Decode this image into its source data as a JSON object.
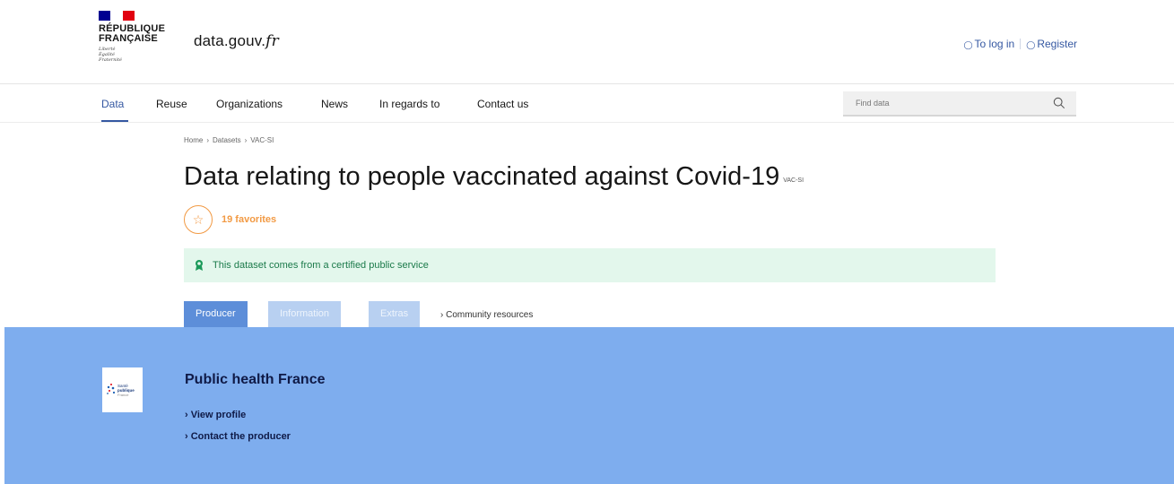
{
  "header": {
    "gov_name_line1": "RÉPUBLIQUE",
    "gov_name_line2": "FRANÇAISE",
    "motto": [
      "Liberté",
      "Égalité",
      "Fraternité"
    ],
    "site_name": "data.gouv.",
    "site_tld": "fr",
    "login_label": "To log in",
    "register_label": "Register"
  },
  "nav": {
    "items": [
      "Data",
      "Reuse",
      "Organizations",
      "News",
      "In regards to",
      "Contact us"
    ],
    "active": "Data",
    "search_placeholder": "Find data"
  },
  "breadcrumb": [
    "Home",
    "Datasets",
    "VAC-SI"
  ],
  "dataset": {
    "title": "Data relating to people vaccinated against Covid-19",
    "acronym": "VAC-SI",
    "favorites": "19 favorites",
    "certified_text": "This dataset comes from a certified public service"
  },
  "tabs": {
    "items": [
      "Producer",
      "Information",
      "Extras"
    ],
    "active": "Producer",
    "community_link": "Community resources"
  },
  "producer": {
    "name": "Public health France",
    "logo_text": [
      "Santé",
      "publique",
      "France"
    ],
    "view_profile": "View profile",
    "contact": "Contact the producer"
  },
  "colors": {
    "primary": "#3558a2",
    "accent_orange": "#f29a44",
    "certified_bg": "#e3f7ec",
    "panel_bg": "#7eadee",
    "tab_active": "#5d8ed9",
    "tab_inactive": "#b8d0f1"
  }
}
